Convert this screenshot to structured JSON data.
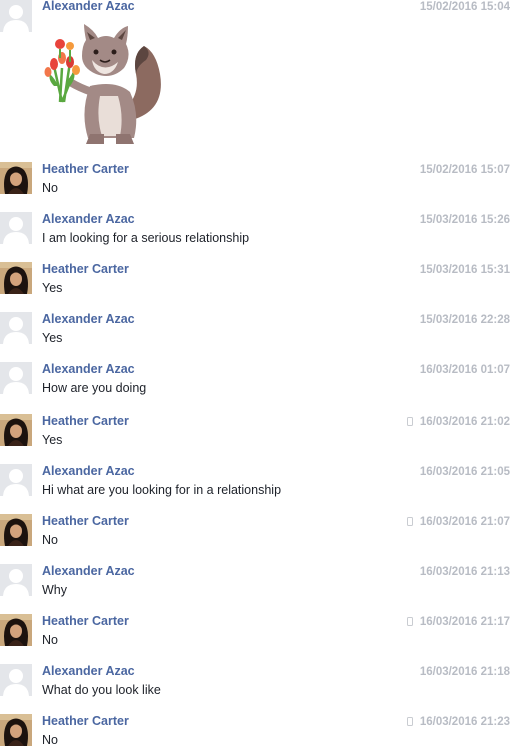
{
  "thread": {
    "messages": [
      {
        "sender": "Alexander Azac",
        "avatar": "default-avatar",
        "time": "15/02/2016 15:04",
        "mobile": false,
        "text": "",
        "sticker": "fox-with-flowers-sticker"
      },
      {
        "sender": "Heather Carter",
        "avatar": "heather-photo",
        "time": "15/02/2016 15:07",
        "mobile": false,
        "text": "No"
      },
      {
        "sender": "Alexander Azac",
        "avatar": "default-avatar",
        "time": "15/03/2016 15:26",
        "mobile": false,
        "text": "I am looking for a serious relationship"
      },
      {
        "sender": "Heather Carter",
        "avatar": "heather-photo",
        "time": "15/03/2016 15:31",
        "mobile": false,
        "text": "Yes"
      },
      {
        "sender": "Alexander Azac",
        "avatar": "default-avatar",
        "time": "15/03/2016 22:28",
        "mobile": false,
        "text": "Yes"
      },
      {
        "sender": "Alexander Azac",
        "avatar": "default-avatar",
        "time": "16/03/2016 01:07",
        "mobile": false,
        "text": "How are you doing"
      },
      {
        "sender": "Heather Carter",
        "avatar": "heather-photo",
        "time": "16/03/2016 21:02",
        "mobile": true,
        "text": "Yes"
      },
      {
        "sender": "Alexander Azac",
        "avatar": "default-avatar",
        "time": "16/03/2016 21:05",
        "mobile": false,
        "text": "Hi what are you looking for in a relationship"
      },
      {
        "sender": "Heather Carter",
        "avatar": "heather-photo",
        "time": "16/03/2016 21:07",
        "mobile": true,
        "text": "No"
      },
      {
        "sender": "Alexander Azac",
        "avatar": "default-avatar",
        "time": "16/03/2016 21:13",
        "mobile": false,
        "text": "Why"
      },
      {
        "sender": "Heather Carter",
        "avatar": "heather-photo",
        "time": "16/03/2016 21:17",
        "mobile": true,
        "text": "No"
      },
      {
        "sender": "Alexander Azac",
        "avatar": "default-avatar",
        "time": "16/03/2016 21:18",
        "mobile": false,
        "text": "What do you look like"
      },
      {
        "sender": "Heather Carter",
        "avatar": "heather-photo",
        "time": "16/03/2016 21:23",
        "mobile": true,
        "text": "No"
      }
    ]
  },
  "icons": {
    "mobile": "mobile-phone-icon"
  },
  "colors": {
    "sender_name": "#4b67a1",
    "timestamp": "#b8bcc4",
    "message_text": "#1d2129",
    "default_avatar_bg": "#e4e6ea"
  }
}
